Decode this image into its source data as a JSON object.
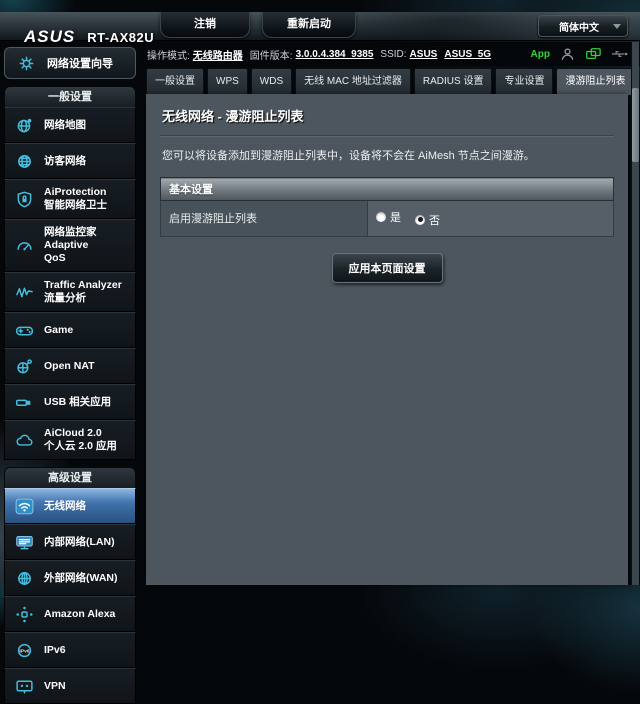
{
  "topbar": {
    "brand": "ASUS",
    "model": "RT-AX82U",
    "logout": "注销",
    "reboot": "重新启动",
    "language": "简体中文"
  },
  "infobar": {
    "mode_label": "操作模式:",
    "mode_value": "无线路由器",
    "fw_label": "固件版本:",
    "fw_value": "3.0.0.4.384_9385",
    "ssid_label": "SSID:",
    "ssid_24": "ASUS",
    "ssid_5": "ASUS_5G",
    "app": "App"
  },
  "tabs": [
    {
      "id": "general",
      "label": "一般设置",
      "active": false
    },
    {
      "id": "wps",
      "label": "WPS",
      "active": false
    },
    {
      "id": "wds",
      "label": "WDS",
      "active": false
    },
    {
      "id": "mac-filter",
      "label": "无线 MAC 地址过滤器",
      "active": false
    },
    {
      "id": "radius",
      "label": "RADIUS 设置",
      "active": false
    },
    {
      "id": "professional",
      "label": "专业设置",
      "active": false
    },
    {
      "id": "roaming-block-list",
      "label": "漫游阻止列表",
      "active": true
    }
  ],
  "content": {
    "title": "无线网络 - 漫游阻止列表",
    "description": "您可以将设备添加到漫游阻止列表中，设备将不会在 AiMesh 节点之间漫游。",
    "section_header": "基本设置",
    "row_label": "启用漫游阻止列表",
    "options": [
      {
        "id": "yes",
        "label": "是",
        "selected": false
      },
      {
        "id": "no",
        "label": "否",
        "selected": true
      }
    ],
    "apply": "应用本页面设置"
  },
  "sidebar": {
    "wizard": "网络设置向导",
    "sections": [
      {
        "title": "一般设置",
        "items": [
          {
            "id": "network-map",
            "lines": [
              "网络地图"
            ],
            "icon": "network-map-icon",
            "active": false
          },
          {
            "id": "guest-network",
            "lines": [
              "访客网络"
            ],
            "icon": "guest-network-icon",
            "active": false
          },
          {
            "id": "aiprotection",
            "lines": [
              "AiProtection",
              "智能网络卫士"
            ],
            "icon": "shield-icon",
            "active": false
          },
          {
            "id": "adaptive-qos",
            "lines": [
              "网络监控家 Adaptive",
              "QoS"
            ],
            "icon": "gauge-icon",
            "active": false
          },
          {
            "id": "traffic-analyzer",
            "lines": [
              "Traffic Analyzer",
              "流量分析"
            ],
            "icon": "traffic-icon",
            "active": false
          },
          {
            "id": "game",
            "lines": [
              "Game"
            ],
            "icon": "game-icon",
            "active": false
          },
          {
            "id": "open-nat",
            "lines": [
              "Open NAT"
            ],
            "icon": "open-nat-icon",
            "active": false
          },
          {
            "id": "usb-app",
            "lines": [
              "USB 相关应用"
            ],
            "icon": "usb-icon",
            "active": false
          },
          {
            "id": "aicloud",
            "lines": [
              "AiCloud 2.0",
              "个人云 2.0 应用"
            ],
            "icon": "cloud-icon",
            "active": false
          }
        ]
      },
      {
        "title": "高级设置",
        "items": [
          {
            "id": "wireless",
            "lines": [
              "无线网络"
            ],
            "icon": "wireless-icon",
            "active": true
          },
          {
            "id": "lan",
            "lines": [
              "内部网络(LAN)"
            ],
            "icon": "lan-icon",
            "active": false
          },
          {
            "id": "wan",
            "lines": [
              "外部网络(WAN)"
            ],
            "icon": "wan-icon",
            "active": false
          },
          {
            "id": "amazon-alexa",
            "lines": [
              "Amazon Alexa"
            ],
            "icon": "alexa-icon",
            "active": false
          },
          {
            "id": "ipv6",
            "lines": [
              "IPv6"
            ],
            "icon": "ipv6-icon",
            "active": false
          },
          {
            "id": "vpn",
            "lines": [
              "VPN"
            ],
            "icon": "vpn-icon",
            "active": false
          }
        ]
      }
    ]
  },
  "colors": {
    "accent_cyan": "#45bede",
    "active_blue": "#3d6ea8",
    "app_green": "#35d43a",
    "panel_gray": "#4d565e"
  }
}
